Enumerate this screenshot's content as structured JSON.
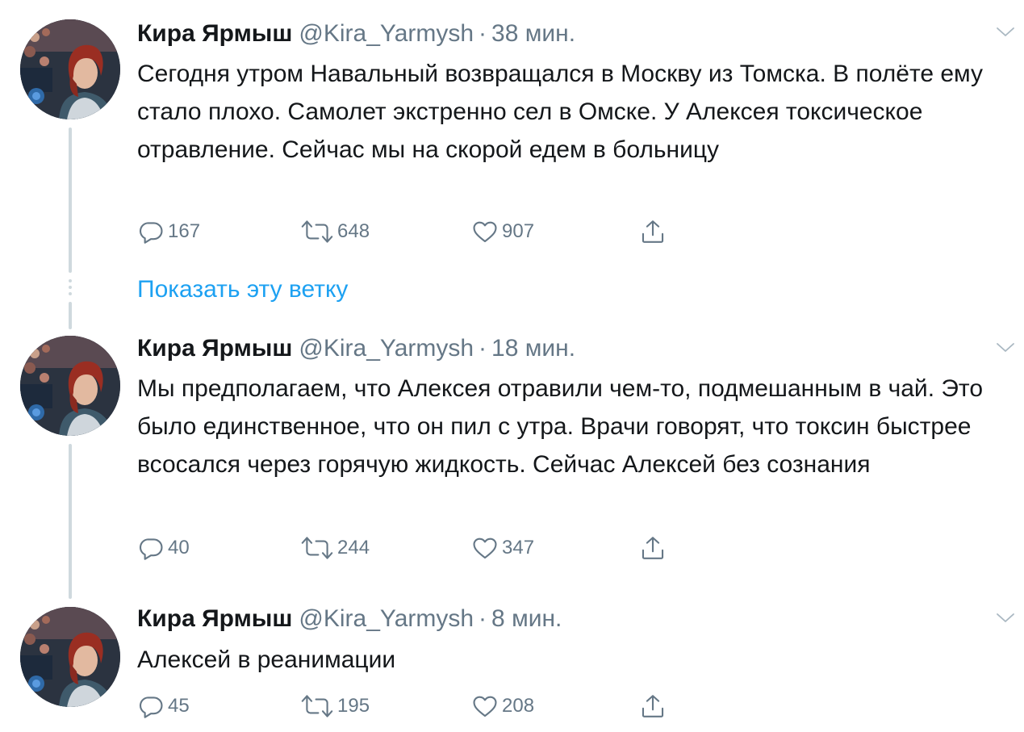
{
  "tweets": [
    {
      "name": "Кира Ярмыш",
      "handle": "@Kira_Yarmysh",
      "separator": "·",
      "time": "38 мин.",
      "text": "Сегодня утром Навальный возвращался в Москву из Томска. В полёте ему стало плохо. Самолет экстренно сел в Омске. У Алексея токсическое отравление. Сейчас мы на скорой едем в больницу",
      "replies": "167",
      "retweets": "648",
      "likes": "907"
    },
    {
      "name": "Кира Ярмыш",
      "handle": "@Kira_Yarmysh",
      "separator": "·",
      "time": "18 мин.",
      "text": "Мы предполагаем, что Алексея отравили чем-то, подмешанным в чай. Это было единственное, что он пил с утра. Врачи говорят, что токсин быстрее всосался через горячую жидкость. Сейчас Алексей без сознания",
      "replies": "40",
      "retweets": "244",
      "likes": "347"
    },
    {
      "name": "Кира Ярмыш",
      "handle": "@Kira_Yarmysh",
      "separator": "·",
      "time": "8 мин.",
      "text": "Алексей в реанимации",
      "replies": "45",
      "retweets": "195",
      "likes": "208"
    }
  ],
  "show_thread_label": "Показать эту ветку",
  "colors": {
    "link": "#1da1f2",
    "muted": "#657786",
    "text": "#14171a",
    "thread_line": "#cfd9de"
  },
  "icons": [
    "reply-icon",
    "retweet-icon",
    "like-icon",
    "share-icon",
    "chevron-down-icon"
  ]
}
